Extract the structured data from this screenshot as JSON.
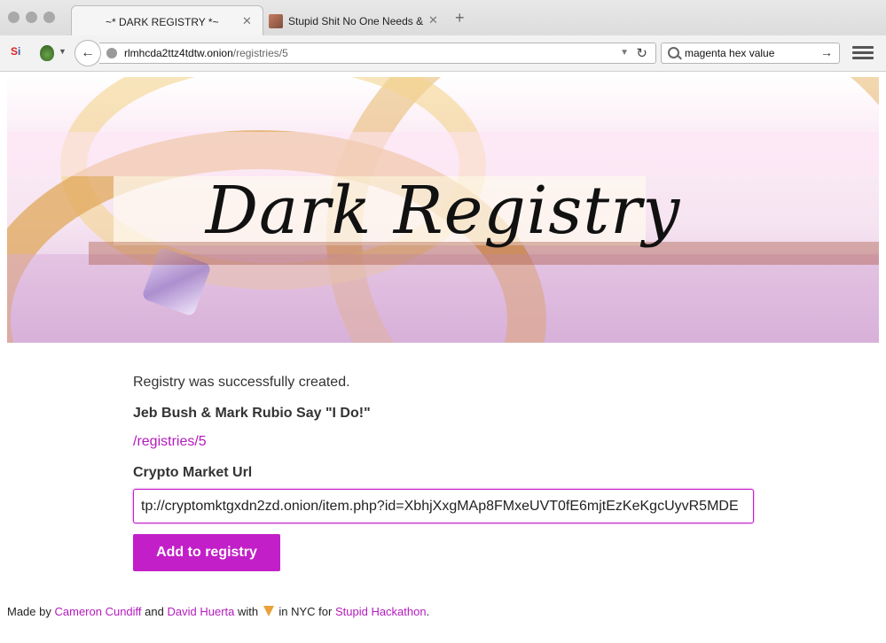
{
  "browser": {
    "tabs": [
      {
        "label": "~* DARK REGISTRY *~",
        "close": "✕",
        "active": true
      },
      {
        "label": "Stupid Shit No One Needs &…",
        "close": "✕",
        "active": false
      }
    ],
    "new_tab": "+",
    "url_host": "rlmhcda2ttz4tdtw.onion",
    "url_path": "/registries/5",
    "search_value": "magenta hex value",
    "icons": {
      "back": "←",
      "reload": "↻",
      "dropdown": "▼",
      "search_go": "→"
    }
  },
  "banner": {
    "title": "Dark Registry"
  },
  "main": {
    "message": "Registry was successfully created.",
    "registry_title": "Jeb Bush & Mark Rubio Say \"I Do!\"",
    "registry_link": "/registries/5",
    "field_label": "Crypto Market Url",
    "field_value": "tp://cryptomktgxdn2zd.onion/item.php?id=XbhjXxgMAp8FMxeUVT0fE6mjtEzKeKgcUyvR5MDE",
    "add_button": "Add to registry"
  },
  "footer": {
    "made_by": "Made by",
    "author1": "Cameron Cundiff",
    "and": "and",
    "author2": "David Huerta",
    "with": "with",
    "in_nyc": "in NYC for",
    "event": "Stupid Hackathon",
    "period": "."
  },
  "colors": {
    "accent": "#c21fc8",
    "link": "#b41bbd"
  }
}
